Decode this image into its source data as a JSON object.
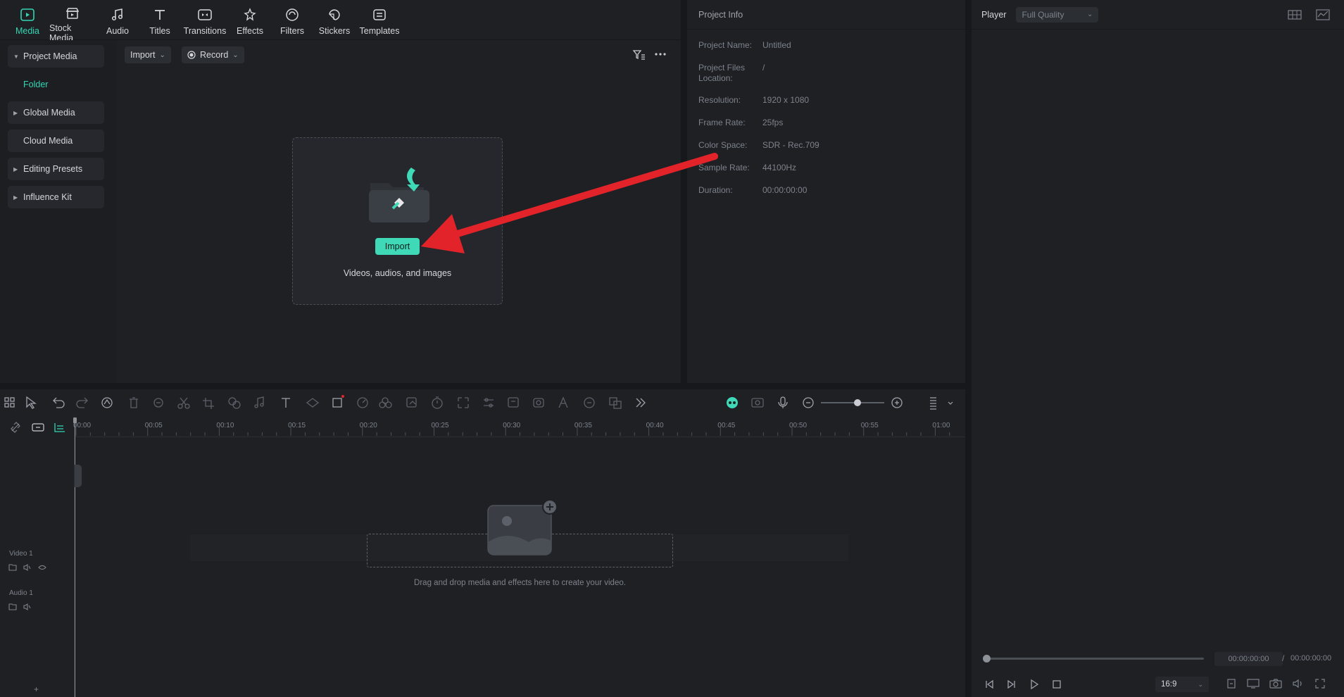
{
  "nav": {
    "tabs": [
      {
        "label": "Media",
        "icon": "media-icon"
      },
      {
        "label": "Stock Media",
        "icon": "stock-media-icon"
      },
      {
        "label": "Audio",
        "icon": "music-note-icon"
      },
      {
        "label": "Titles",
        "icon": "text-t-icon"
      },
      {
        "label": "Transitions",
        "icon": "transitions-icon"
      },
      {
        "label": "Effects",
        "icon": "effects-icon"
      },
      {
        "label": "Filters",
        "icon": "filters-icon"
      },
      {
        "label": "Stickers",
        "icon": "stickers-icon"
      },
      {
        "label": "Templates",
        "icon": "templates-icon"
      }
    ],
    "active": "Media"
  },
  "sidebar": {
    "items": [
      {
        "label": "Project Media",
        "expanded": true
      },
      {
        "label": "Folder",
        "sub": true
      },
      {
        "label": "Global Media"
      },
      {
        "label": "Cloud Media"
      },
      {
        "label": "Editing Presets"
      },
      {
        "label": "Influence Kit"
      }
    ]
  },
  "media": {
    "import_label": "Import",
    "record_label": "Record",
    "drop_button": "Import",
    "drop_text": "Videos, audios, and images"
  },
  "project_info": {
    "title": "Project Info",
    "rows": [
      {
        "key": "Project Name:",
        "value": "Untitled"
      },
      {
        "key": "Project Files Location:",
        "value": "/"
      },
      {
        "key": "Resolution:",
        "value": "1920 x 1080"
      },
      {
        "key": "Frame Rate:",
        "value": "25fps"
      },
      {
        "key": "Color Space:",
        "value": "SDR - Rec.709"
      },
      {
        "key": "Sample Rate:",
        "value": "44100Hz"
      },
      {
        "key": "Duration:",
        "value": "00:00:00:00"
      }
    ]
  },
  "player": {
    "title": "Player",
    "quality": "Full Quality",
    "current_time": "00:00:00:00",
    "total_time": "00:00:00:00",
    "separator": "/",
    "aspect": "16:9"
  },
  "timeline": {
    "ruler": [
      "00:00",
      "00:05",
      "00:10",
      "00:15",
      "00:20",
      "00:25",
      "00:30",
      "00:35",
      "00:40",
      "00:45",
      "00:50",
      "00:55",
      "01:00"
    ],
    "tracks": [
      "Video 1",
      "Audio 1"
    ],
    "drop_hint": "Drag and drop media and effects here to create your video."
  },
  "colors": {
    "accent": "#3fd9b8",
    "annotation_arrow": "#e3232a"
  }
}
